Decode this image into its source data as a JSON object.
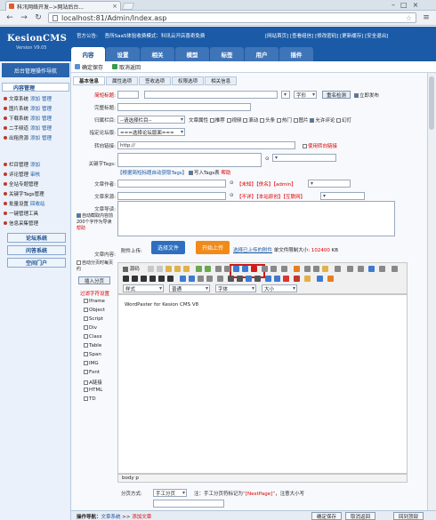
{
  "browser": {
    "tab_title": "科汛网络开发-->网站后台...",
    "url": "localhost:81/Admin/Index.asp"
  },
  "header": {
    "logo": "KesionCMS",
    "version": "Version V9.05",
    "notice_label": "官方公告:",
    "notice_text": "吾所SaaS体验收费模式：科讯云开店喜奇免费",
    "top_links": "[网站首页] [查看组信] [修改密码] [更新缓存] [安全退出]",
    "tabs": [
      "内容",
      "设置",
      "相关",
      "模型",
      "标签",
      "用户",
      "插件"
    ]
  },
  "subbar": {
    "save": "确定保存",
    "cancel": "取消返回"
  },
  "sidebar": {
    "title": "后台管理操作导航",
    "section1": "内容管理",
    "items1": [
      {
        "name": "文章系统",
        "a": "添加",
        "b": "管理"
      },
      {
        "name": "图片系统",
        "a": "添加",
        "b": "管理"
      },
      {
        "name": "下载系统",
        "a": "添加",
        "b": "管理"
      },
      {
        "name": "二手频道",
        "a": "添加",
        "b": "管理"
      },
      {
        "name": "出租房源",
        "a": "添加",
        "b": "管理"
      }
    ],
    "items2": [
      {
        "name": "栏目管理",
        "a": "添加"
      },
      {
        "name": "评论管理",
        "a": "审核"
      },
      {
        "name": "全站专题管理",
        "a": ""
      },
      {
        "name": "关键字Tags管理",
        "a": ""
      },
      {
        "name": "批量设置",
        "a": "回收站"
      },
      {
        "name": "一键管理工具",
        "a": ""
      },
      {
        "name": "信息采集管理",
        "a": ""
      }
    ],
    "buttons": [
      "论坛系统",
      "问答系统",
      "空间门户"
    ]
  },
  "form": {
    "tabs": [
      "基本信息",
      "属性选项",
      "签收选项",
      "权限选项",
      "相关信息"
    ],
    "labels": {
      "title": "简短标题:",
      "full_title": "完整标题:",
      "column": "归属栏目:",
      "template": "指定论坛版:",
      "redirect": "转向链接:",
      "tags": "关键字Tags:",
      "author": "文章作者:",
      "source": "文章来源:",
      "intro": "文章导读:",
      "content": "文章内容:",
      "attach": "附件上传:"
    },
    "title_select": "字形",
    "check_repeat": "重名检测",
    "first_display": "立即发布",
    "column_select": "--请选择栏目--",
    "attr_label": "文章属性",
    "attrs": [
      "推荐",
      "视频",
      "滚动",
      "头条",
      "热门",
      "图片",
      "允许评论",
      "幻灯"
    ],
    "attr_checked": [
      false,
      false,
      false,
      false,
      false,
      false,
      true,
      false
    ],
    "template_select": "===选择论坛版面===",
    "redirect_value": "http://",
    "use_redirect": "使用转向链接",
    "tags_auto": "【根据简短标题自动获取Tags】",
    "tags_write": "写入Tags表",
    "tags_help": "帮助",
    "author_links": "【未知】【佚名】【admin】",
    "source_links": "【不详】【本站原创】【互联网】",
    "auto_intro": "自动截取内容前200个字作为导读",
    "auto_intro_help": "帮助",
    "auto_page": "自动分页时每页约",
    "insert_page": "插入分页",
    "filter_title": "过滤字符设置",
    "filters": [
      "Iframe",
      "Object",
      "Script",
      "Div",
      "Class",
      "Table",
      "Span",
      "IMG",
      "Font",
      "A链接",
      "HTML",
      "TD"
    ],
    "select_file": "选择文件",
    "start_upload": "开始上传",
    "upload_hint": "选择已上传的附件",
    "size_limit": "单文件限制大小:",
    "size_value": "102400",
    "size_unit": "KB",
    "editor_text": "WordPaster for Kesion CMS V8",
    "editor_status": "body p",
    "toolbar_source": "源码",
    "font_style": "样式",
    "font_normal": "普通",
    "font_family": "字体",
    "font_size": "大小",
    "paging_label": "分页方式:",
    "paging_select": "手工分页",
    "paging_note_pre": "注：手工分页符标记为",
    "paging_mark": "“[NextPage]”",
    "paging_note_post": "，注意大小写"
  },
  "bottom": {
    "op_label": "操作导航：",
    "op_path": "文章系统",
    "op_sep": ">>",
    "op_current": "添加文章",
    "btn_save": "确定保存",
    "btn_back": "取消返回",
    "btn_top": "回到顶部"
  },
  "colors": {
    "header_blue": "#1b5aa6",
    "highlight_red": "#d11a1a",
    "upload_orange": "#f28a1a"
  }
}
